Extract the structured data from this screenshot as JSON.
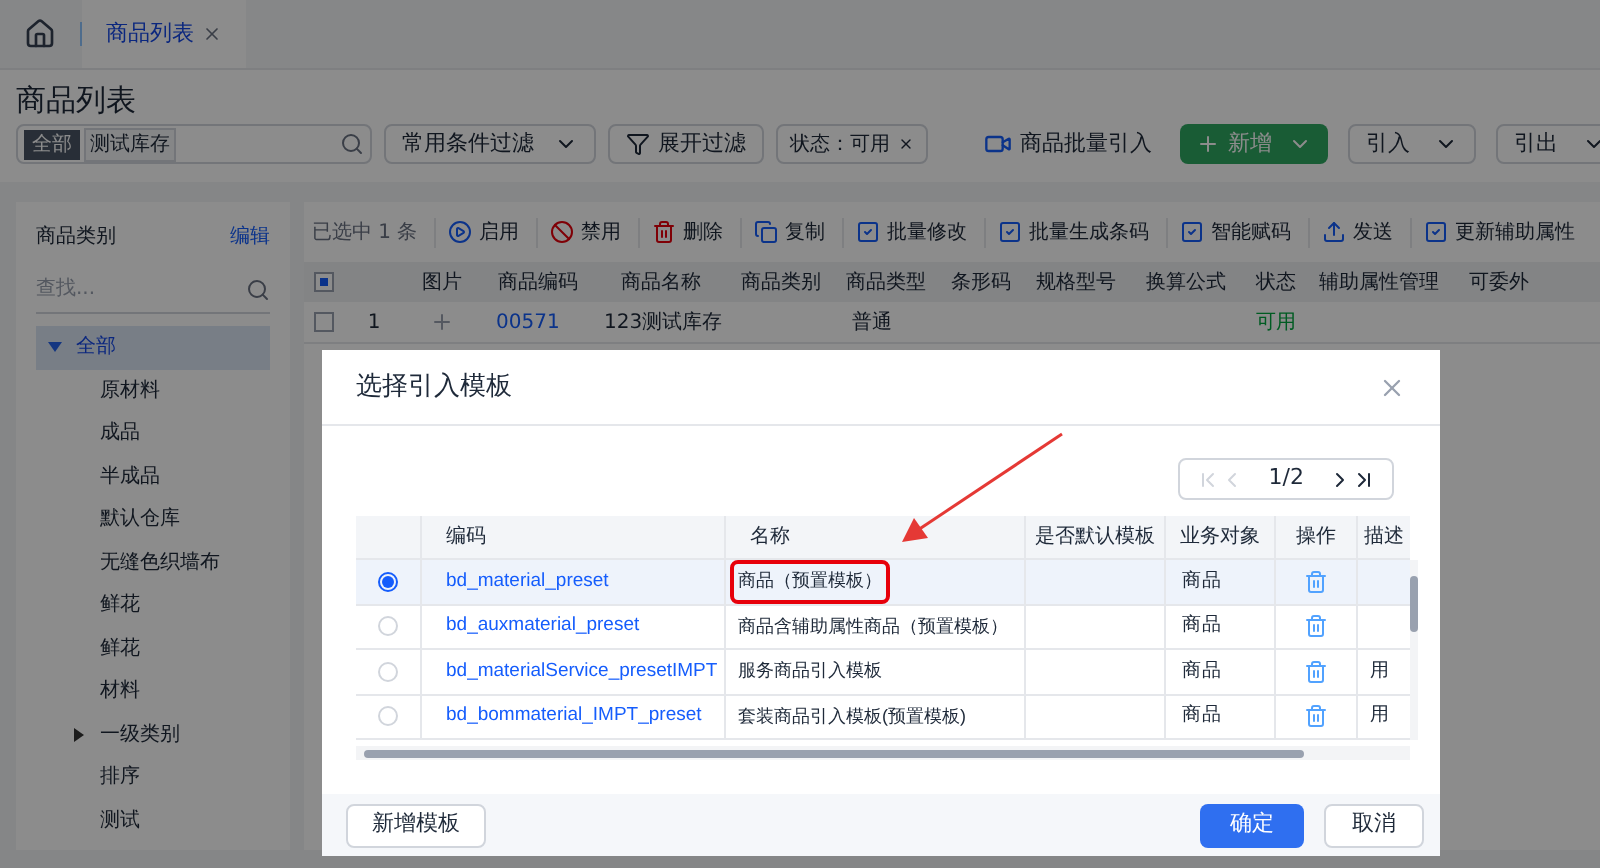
{
  "top_tabs": [
    {
      "label": "商品列表",
      "selected": true
    }
  ],
  "page_title": "商品列表",
  "search": {
    "scope": "全部",
    "keyword": "测试库存"
  },
  "filter_dropdown": "常用条件过滤",
  "expand_filter_button": "展开过滤",
  "filter_tag": "状态：可用",
  "batch_import_link": "商品批量引入",
  "add_button": "新增",
  "import_button": "引入",
  "export_button": "引出",
  "sidebar": {
    "title": "商品类别",
    "edit_link": "编辑",
    "search_placeholder": "查找...",
    "tree": [
      {
        "label": "全部",
        "selected": true,
        "expanded": true,
        "children": [
          {
            "label": "原材料",
            "selected": false
          },
          {
            "label": "成品",
            "selected": false
          },
          {
            "label": "半成品",
            "selected": false
          },
          {
            "label": "默认仓库",
            "selected": false
          },
          {
            "label": "无缝色织墙布",
            "selected": false
          },
          {
            "label": "鲜花",
            "selected": false
          },
          {
            "label": "鲜花",
            "selected": false
          },
          {
            "label": "材料",
            "selected": false
          },
          {
            "label": "一级类别",
            "selected": false,
            "expanded": false
          },
          {
            "label": "排序",
            "selected": false
          },
          {
            "label": "测试",
            "selected": false
          }
        ]
      }
    ]
  },
  "toolbar": {
    "selection_count": "已选中 1 条",
    "actions": [
      {
        "label": "启用",
        "kind": "enable"
      },
      {
        "label": "禁用",
        "kind": "disable"
      },
      {
        "label": "删除",
        "kind": "delete"
      },
      {
        "label": "复制",
        "kind": "copy"
      },
      {
        "label": "批量修改",
        "kind": "check"
      },
      {
        "label": "批量生成条码",
        "kind": "check"
      },
      {
        "label": "智能赋码",
        "kind": "check"
      },
      {
        "label": "发送",
        "kind": "send"
      },
      {
        "label": "更新辅助属性",
        "kind": "check"
      }
    ]
  },
  "grid": {
    "header_indeterminate": true,
    "columns": [
      "图片",
      "商品编码",
      "商品名称",
      "商品类别",
      "商品类型",
      "条形码",
      "规格型号",
      "换算公式",
      "状态",
      "辅助属性管理",
      "可委外"
    ],
    "rows": [
      {
        "checked": false,
        "index": "1",
        "code": "00571",
        "name": "123测试库存",
        "type": "普通",
        "status": "可用"
      }
    ]
  },
  "dialog": {
    "title": "选择引入模板",
    "pager": "1/2",
    "columns": [
      "编码",
      "名称",
      "是否默认模板",
      "业务对象",
      "操作",
      "描述"
    ],
    "rows": [
      {
        "selected": true,
        "highlighted": true,
        "code": "bd_material_preset",
        "name": "商品（预置模板）",
        "object": "商品"
      },
      {
        "selected": false,
        "highlighted": false,
        "code": "bd_auxmaterial_preset",
        "name": "商品含辅助属性商品（预置模板）",
        "object": "商品"
      },
      {
        "selected": false,
        "highlighted": false,
        "code": "bd_materialService_presetIMPT",
        "name": "服务商品引入模板",
        "object": "商品",
        "description": "用"
      },
      {
        "selected": false,
        "highlighted": false,
        "code": "bd_bommaterial_IMPT_preset",
        "name": "套装商品引入模板(预置模板)",
        "object": "商品",
        "description": "用"
      }
    ],
    "add_template_button": "新增模板",
    "confirm_button": "确定",
    "cancel_button": "取消"
  }
}
